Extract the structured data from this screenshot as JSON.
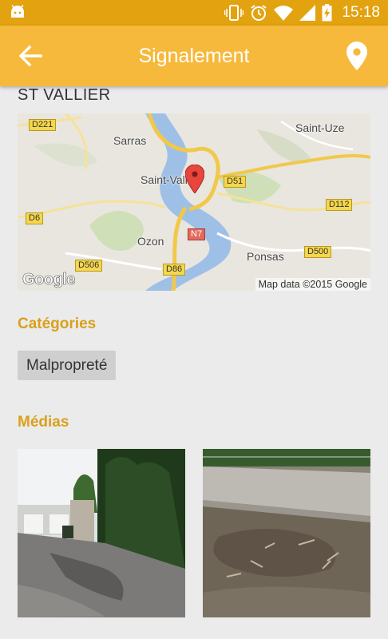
{
  "status_bar": {
    "time": "15:18"
  },
  "app_bar": {
    "title": "Signalement"
  },
  "report": {
    "city": "ST VALLIER",
    "map": {
      "credit": "Map data ©2015 Google",
      "logo": "Google",
      "towns": [
        "Sarras",
        "Saint-Uze",
        "Saint-Vallier",
        "Ozon",
        "Ponsas"
      ],
      "roads": [
        "D221",
        "D51",
        "D6",
        "D112",
        "N7",
        "D506",
        "D86",
        "D500"
      ]
    },
    "categories_title": "Catégories",
    "category": "Malpropreté",
    "media_title": "Médias",
    "media": [
      {
        "name": "photo-alley"
      },
      {
        "name": "photo-wall-dirt"
      }
    ]
  },
  "colors": {
    "status_bar": "#e3a20f",
    "app_bar": "#f6b93b",
    "accent": "#d9a01b",
    "background": "#ebebeb"
  },
  "icons": [
    "android-icon",
    "vibrate-icon",
    "alarm-icon",
    "wifi-icon",
    "signal-icon",
    "battery-charging-icon",
    "back-arrow-icon",
    "location-pin-icon",
    "map-marker-icon"
  ]
}
